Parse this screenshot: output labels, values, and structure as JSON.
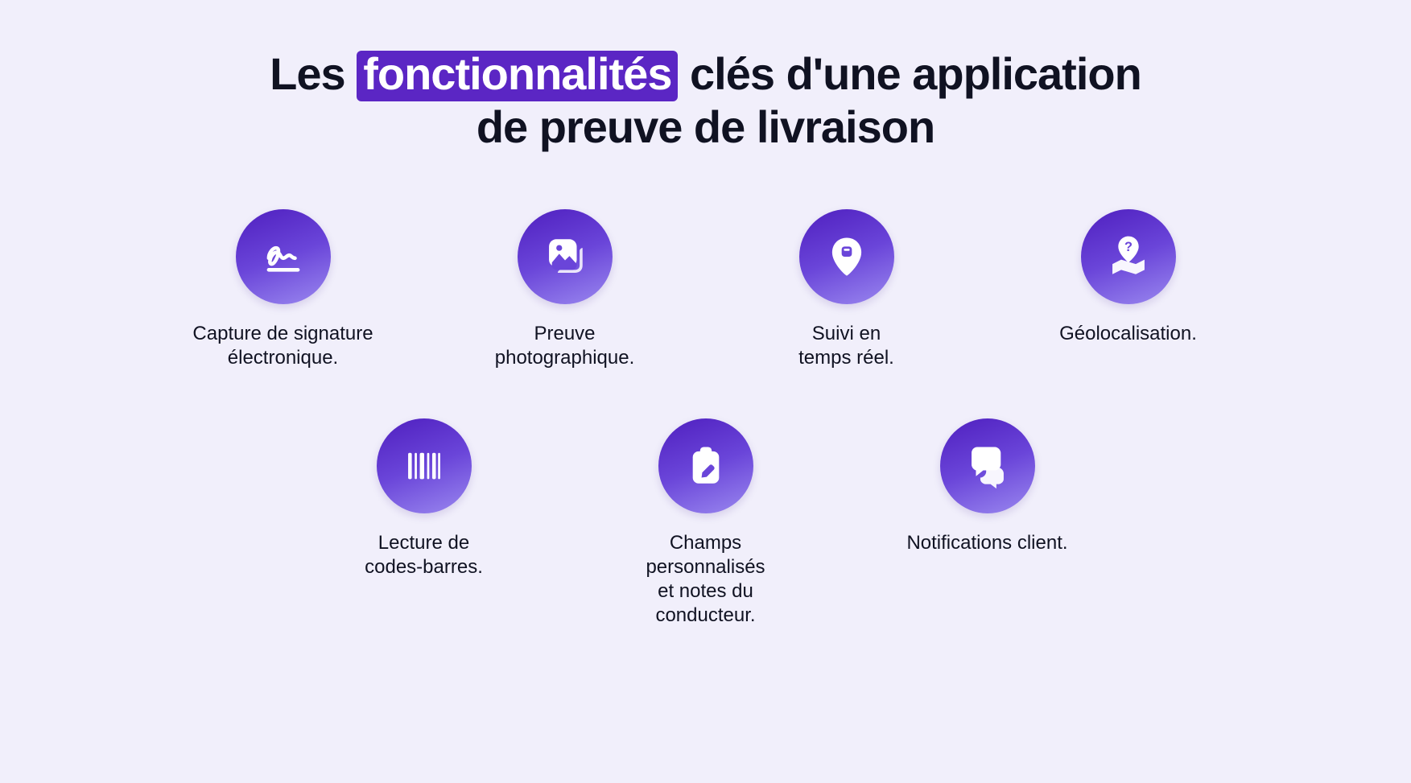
{
  "heading": {
    "pre": "Les ",
    "highlight": "fonctionnalités",
    "post": " clés d'une application\nde preuve de livraison"
  },
  "features": {
    "row1": [
      {
        "icon": "signature-icon",
        "label": "Capture de signature\nélectronique."
      },
      {
        "icon": "photo-icon",
        "label": "Preuve\nphotographique."
      },
      {
        "icon": "pin-icon",
        "label": "Suivi en\ntemps réel."
      },
      {
        "icon": "map-question-icon",
        "label": "Géolocalisation."
      }
    ],
    "row2": [
      {
        "icon": "barcode-icon",
        "label": "Lecture de\ncodes-barres."
      },
      {
        "icon": "clipboard-edit-icon",
        "label": "Champs personnalisés\net notes du conducteur."
      },
      {
        "icon": "chat-icon",
        "label": "Notifications client."
      }
    ]
  },
  "colors": {
    "background": "#f1effb",
    "text": "#101222",
    "highlight_bg": "#5b26c4",
    "highlight_text": "#ffffff",
    "icon_gradient_start": "#4f1fbf",
    "icon_gradient_end": "#9a88ef"
  }
}
